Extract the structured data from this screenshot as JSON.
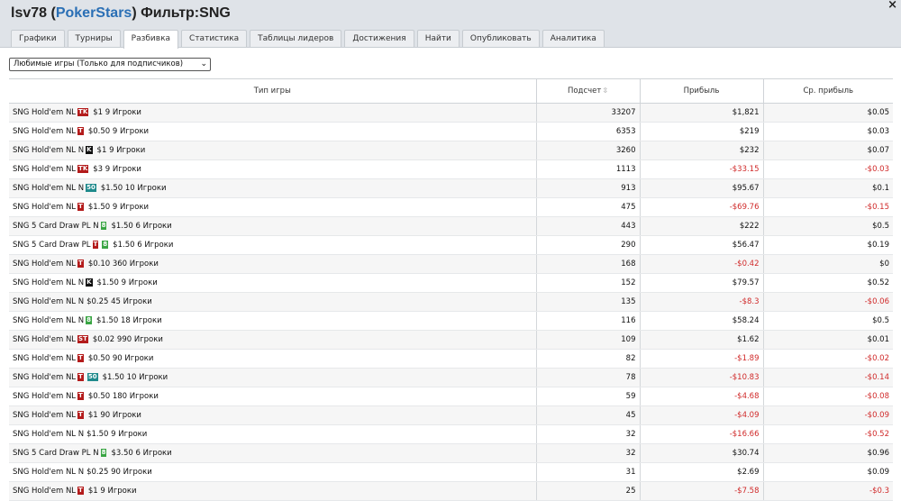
{
  "header": {
    "player": "lsv78",
    "site": "PokerStars",
    "filter_label": "Фильтр:",
    "filter_value": "SNG",
    "close_icon": "×"
  },
  "tabs": [
    {
      "label": "Графики"
    },
    {
      "label": "Турниры"
    },
    {
      "label": "Разбивка"
    },
    {
      "label": "Статистика"
    },
    {
      "label": "Таблицы лидеров"
    },
    {
      "label": "Достижения"
    },
    {
      "label": "Найти"
    },
    {
      "label": "Опубликовать"
    },
    {
      "label": "Аналитика"
    }
  ],
  "active_tab": 2,
  "favorites_select": {
    "value": "Любимые игры (Только для подписчиков)"
  },
  "table": {
    "columns": [
      "Тип игры",
      "Подсчет",
      "Прибыль",
      "Ср. прибыль"
    ],
    "rows": [
      {
        "pre": "SNG Hold'em NL",
        "badges": [
          "TK"
        ],
        "post": "$1 9 Игроки",
        "count": "33207",
        "profit": "$1,821",
        "avg": "$0.05"
      },
      {
        "pre": "SNG Hold'em NL",
        "badges": [
          "T"
        ],
        "post": "$0.50 9 Игроки",
        "count": "6353",
        "profit": "$219",
        "avg": "$0.03"
      },
      {
        "pre": "SNG Hold'em NL N",
        "badges": [
          "K"
        ],
        "post": "$1 9 Игроки",
        "count": "3260",
        "profit": "$232",
        "avg": "$0.07"
      },
      {
        "pre": "SNG Hold'em NL",
        "badges": [
          "TK"
        ],
        "post": "$3 9 Игроки",
        "count": "1113",
        "profit": "-$33.15",
        "avg": "-$0.03"
      },
      {
        "pre": "SNG Hold'em NL N",
        "badges": [
          "50"
        ],
        "post": "$1.50 10 Игроки",
        "count": "913",
        "profit": "$95.67",
        "avg": "$0.1"
      },
      {
        "pre": "SNG Hold'em NL",
        "badges": [
          "T"
        ],
        "post": "$1.50 9 Игроки",
        "count": "475",
        "profit": "-$69.76",
        "avg": "-$0.15"
      },
      {
        "pre": "SNG 5 Card Draw PL N",
        "badges": [
          "8"
        ],
        "post": "$1.50 6 Игроки",
        "count": "443",
        "profit": "$222",
        "avg": "$0.5"
      },
      {
        "pre": "SNG 5 Card Draw PL",
        "badges": [
          "T",
          "8"
        ],
        "post": "$1.50 6 Игроки",
        "count": "290",
        "profit": "$56.47",
        "avg": "$0.19"
      },
      {
        "pre": "SNG Hold'em NL",
        "badges": [
          "T"
        ],
        "post": "$0.10 360 Игроки",
        "count": "168",
        "profit": "-$0.42",
        "avg": "$0"
      },
      {
        "pre": "SNG Hold'em NL N",
        "badges": [
          "K"
        ],
        "post": "$1.50 9 Игроки",
        "count": "152",
        "profit": "$79.57",
        "avg": "$0.52"
      },
      {
        "pre": "SNG Hold'em NL N",
        "badges": [],
        "post": "$0.25 45 Игроки",
        "count": "135",
        "profit": "-$8.3",
        "avg": "-$0.06"
      },
      {
        "pre": "SNG Hold'em NL N",
        "badges": [
          "8"
        ],
        "post": "$1.50 18 Игроки",
        "count": "116",
        "profit": "$58.24",
        "avg": "$0.5"
      },
      {
        "pre": "SNG Hold'em NL",
        "badges": [
          "ST"
        ],
        "post": "$0.02 990 Игроки",
        "count": "109",
        "profit": "$1.62",
        "avg": "$0.01"
      },
      {
        "pre": "SNG Hold'em NL",
        "badges": [
          "T"
        ],
        "post": "$0.50 90 Игроки",
        "count": "82",
        "profit": "-$1.89",
        "avg": "-$0.02"
      },
      {
        "pre": "SNG Hold'em NL",
        "badges": [
          "T",
          "50"
        ],
        "post": "$1.50 10 Игроки",
        "count": "78",
        "profit": "-$10.83",
        "avg": "-$0.14"
      },
      {
        "pre": "SNG Hold'em NL",
        "badges": [
          "T"
        ],
        "post": "$0.50 180 Игроки",
        "count": "59",
        "profit": "-$4.68",
        "avg": "-$0.08"
      },
      {
        "pre": "SNG Hold'em NL",
        "badges": [
          "T"
        ],
        "post": "$1 90 Игроки",
        "count": "45",
        "profit": "-$4.09",
        "avg": "-$0.09"
      },
      {
        "pre": "SNG Hold'em NL N",
        "badges": [],
        "post": "$1.50 9 Игроки",
        "count": "32",
        "profit": "-$16.66",
        "avg": "-$0.52"
      },
      {
        "pre": "SNG 5 Card Draw PL N",
        "badges": [
          "8"
        ],
        "post": "$3.50 6 Игроки",
        "count": "32",
        "profit": "$30.74",
        "avg": "$0.96"
      },
      {
        "pre": "SNG Hold'em NL N",
        "badges": [],
        "post": "$0.25 90 Игроки",
        "count": "31",
        "profit": "$2.69",
        "avg": "$0.09"
      },
      {
        "pre": "SNG Hold'em NL",
        "badges": [
          "T"
        ],
        "post": "$1 9 Игроки",
        "count": "25",
        "profit": "-$7.58",
        "avg": "-$0.3"
      }
    ]
  },
  "colors": {
    "negative": "#d02a2a",
    "link": "#2a6fb5"
  }
}
